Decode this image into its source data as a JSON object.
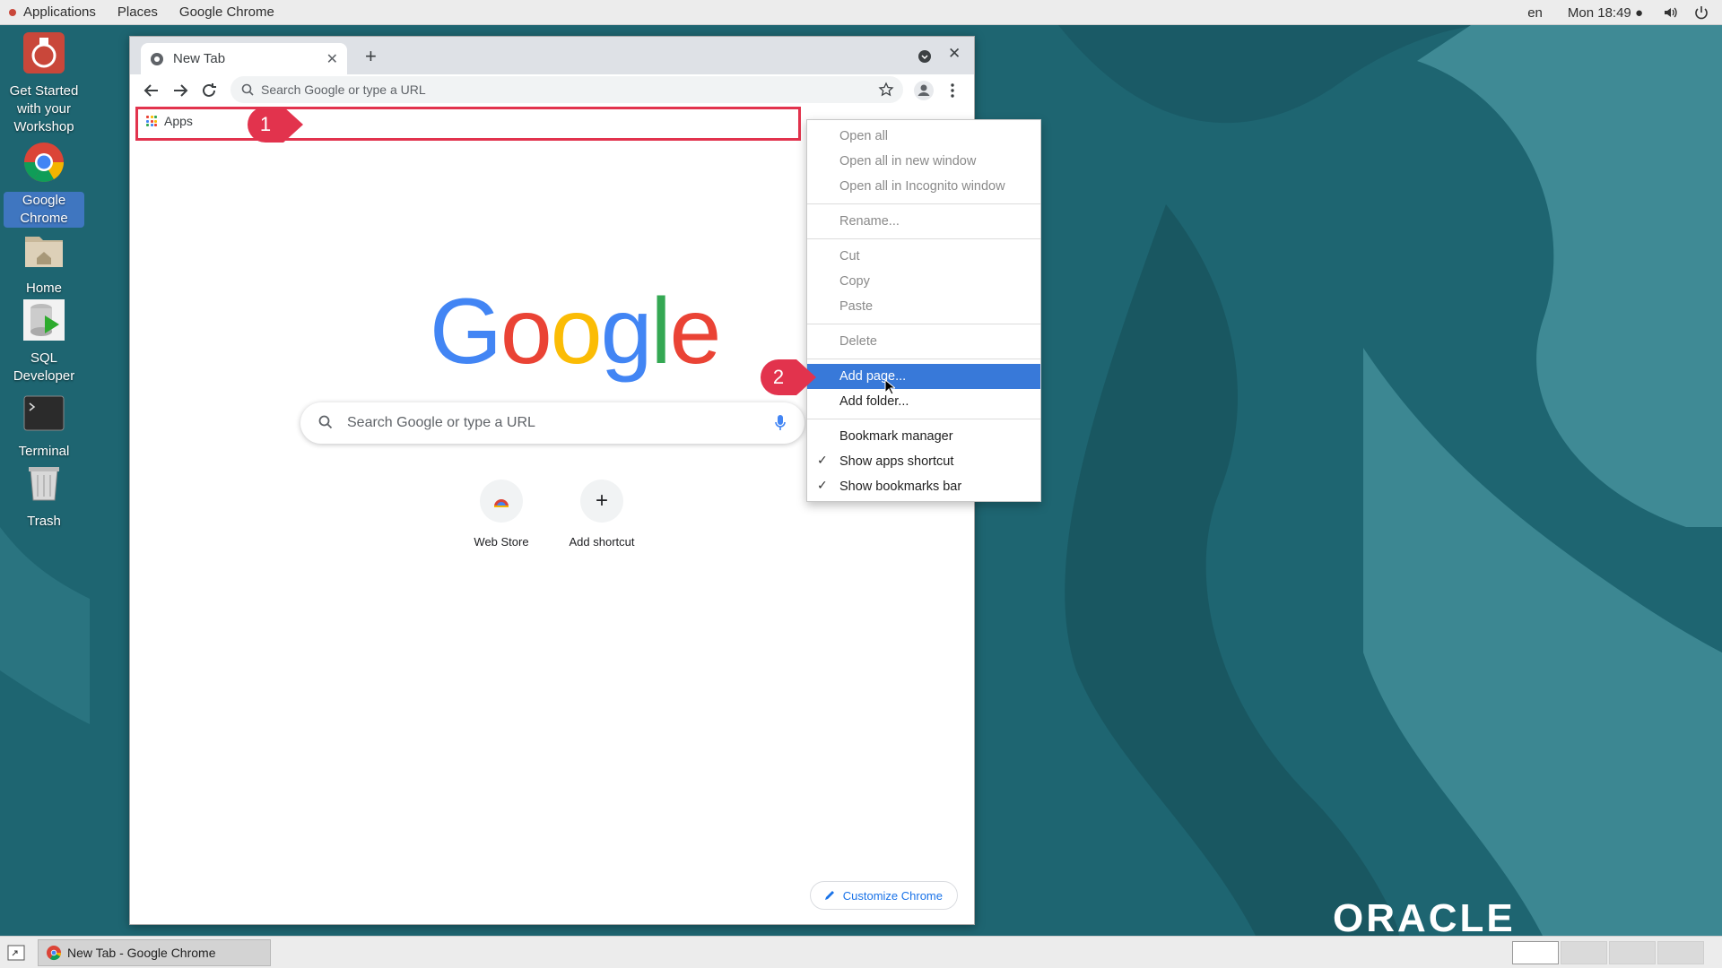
{
  "topbar": {
    "applications": "Applications",
    "places": "Places",
    "app_name": "Google Chrome",
    "lang": "en",
    "clock": "Mon 18:49"
  },
  "desktop": [
    {
      "name": "get-started",
      "label": "Get Started with your Workshop"
    },
    {
      "name": "google-chrome",
      "label": "Google Chrome"
    },
    {
      "name": "home",
      "label": "Home"
    },
    {
      "name": "sql-developer",
      "label": "SQL Developer"
    },
    {
      "name": "terminal",
      "label": "Terminal"
    },
    {
      "name": "trash",
      "label": "Trash"
    }
  ],
  "chrome": {
    "tab_title": "New Tab",
    "omnibox_placeholder": "Search Google or type a URL",
    "apps_label": "Apps",
    "google_logo": [
      "G",
      "o",
      "o",
      "g",
      "l",
      "e"
    ],
    "ntp_search_placeholder": "Search Google or type a URL",
    "shortcuts": [
      {
        "label": "Web Store"
      },
      {
        "label": "Add shortcut",
        "glyph": "+"
      }
    ],
    "customize_label": "Customize Chrome"
  },
  "context_menu": {
    "items": [
      {
        "label": "Open all",
        "disabled": true
      },
      {
        "label": "Open all in new window",
        "disabled": true
      },
      {
        "label": "Open all in Incognito window",
        "disabled": true
      },
      {
        "label": "Rename...",
        "disabled": true
      },
      {
        "label": "Cut",
        "disabled": true
      },
      {
        "label": "Copy",
        "disabled": true
      },
      {
        "label": "Paste",
        "disabled": true
      },
      {
        "label": "Delete",
        "disabled": true
      },
      {
        "label": "Add page...",
        "active": true
      },
      {
        "label": "Add folder..."
      },
      {
        "label": "Bookmark manager"
      },
      {
        "label": "Show apps shortcut",
        "checked": true
      },
      {
        "label": "Show bookmarks bar",
        "checked": true
      }
    ],
    "checkmark": "✓"
  },
  "callouts": [
    "1",
    "2"
  ],
  "taskbar": {
    "window_title": "New Tab - Google Chrome"
  },
  "branding": "ORACLE",
  "colors": {
    "desktop_bg": "#1f6470",
    "menu_highlight": "#3879d9",
    "callout_red": "#e2334d",
    "google_blue": "#4285f4",
    "google_red": "#ea4335",
    "google_yellow": "#fbbc05",
    "google_green": "#34a853"
  }
}
